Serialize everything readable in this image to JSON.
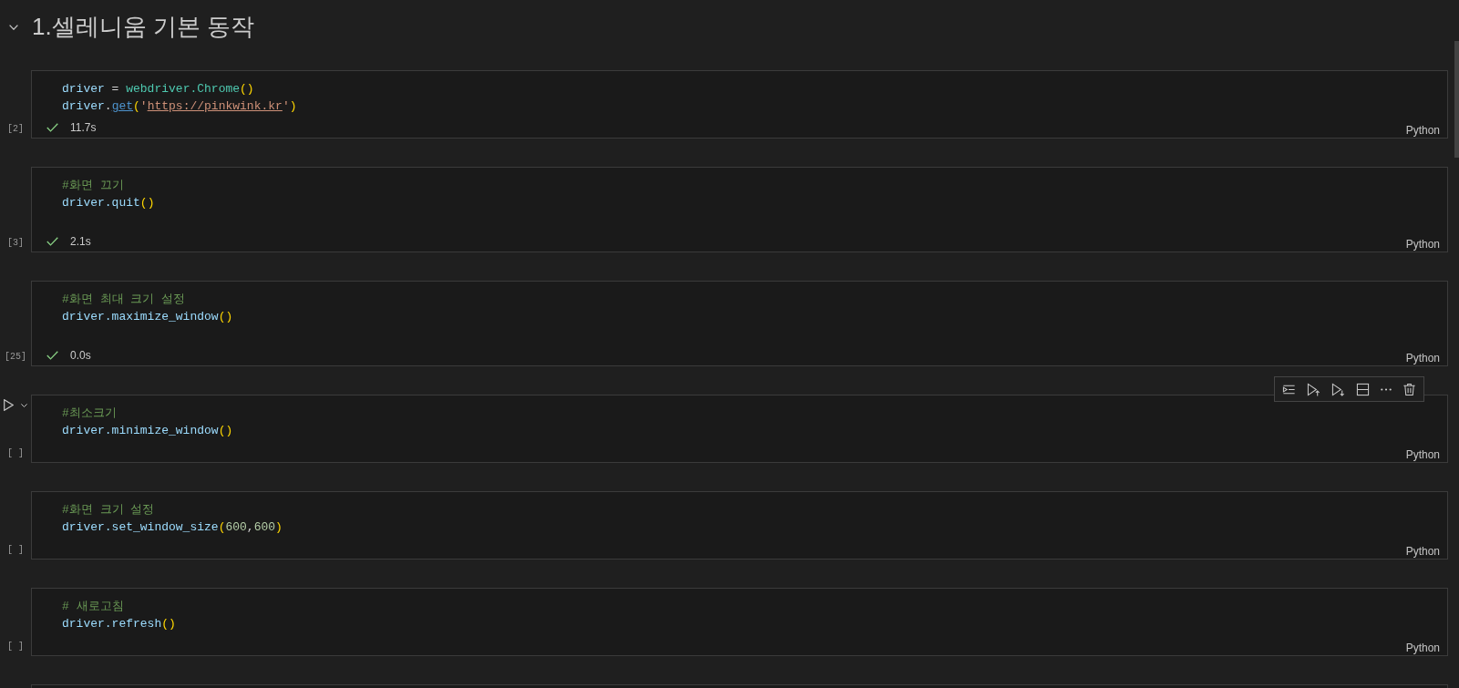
{
  "heading": {
    "text": "1.셀레니움 기본 동작",
    "expanded": true
  },
  "cells": [
    {
      "execution_count": "[2]",
      "focused": false,
      "blank_last_line": false,
      "lines": [
        [
          {
            "kind": "name",
            "text": "driver"
          },
          {
            "kind": "operator",
            "text": " = "
          },
          {
            "kind": "module",
            "text": "webdriver.Chrome"
          },
          {
            "kind": "bracket",
            "text": "()"
          }
        ],
        [
          {
            "kind": "name",
            "text": "driver"
          },
          {
            "kind": "operator",
            "text": "."
          },
          {
            "kind": "method_link",
            "text": "get"
          },
          {
            "kind": "bracket",
            "text": "("
          },
          {
            "kind": "string",
            "text": "'"
          },
          {
            "kind": "url",
            "text": "https://pinkwink.kr"
          },
          {
            "kind": "string",
            "text": "'"
          },
          {
            "kind": "bracket",
            "text": ")"
          }
        ]
      ],
      "status": {
        "succeeded": true,
        "duration": "11.7s"
      },
      "language": "Python"
    },
    {
      "execution_count": "[3]",
      "focused": false,
      "blank_last_line": true,
      "lines": [
        [
          {
            "kind": "comment",
            "text": "#화면 끄기"
          }
        ],
        [
          {
            "kind": "name",
            "text": "driver.quit"
          },
          {
            "kind": "bracket",
            "text": "()"
          }
        ]
      ],
      "status": {
        "succeeded": true,
        "duration": "2.1s"
      },
      "language": "Python"
    },
    {
      "execution_count": "[25]",
      "focused": false,
      "blank_last_line": true,
      "lines": [
        [
          {
            "kind": "comment",
            "text": "#화면 최대 크기 설정"
          }
        ],
        [
          {
            "kind": "name",
            "text": "driver.maximize_window"
          },
          {
            "kind": "bracket",
            "text": "()"
          }
        ]
      ],
      "status": {
        "succeeded": true,
        "duration": "0.0s"
      },
      "language": "Python"
    },
    {
      "execution_count": "[ ]",
      "focused": true,
      "blank_last_line": false,
      "lines": [
        [
          {
            "kind": "comment",
            "text": "#최소크기"
          }
        ],
        [
          {
            "kind": "name",
            "text": "driver.minimize_window"
          },
          {
            "kind": "bracket",
            "text": "()"
          }
        ]
      ],
      "language": "Python"
    },
    {
      "execution_count": "[ ]",
      "focused": false,
      "blank_last_line": false,
      "lines": [
        [
          {
            "kind": "comment",
            "text": "#화면 크기 설정"
          }
        ],
        [
          {
            "kind": "name",
            "text": "driver.set_window_size"
          },
          {
            "kind": "bracket",
            "text": "("
          },
          {
            "kind": "number",
            "text": "600"
          },
          {
            "kind": "operator",
            "text": ","
          },
          {
            "kind": "number",
            "text": "600"
          },
          {
            "kind": "bracket",
            "text": ")"
          }
        ]
      ],
      "language": "Python"
    },
    {
      "execution_count": "[ ]",
      "focused": false,
      "blank_last_line": false,
      "lines": [
        [
          {
            "kind": "comment",
            "text": "# 새로고침"
          }
        ],
        [
          {
            "kind": "name",
            "text": "driver.refresh"
          },
          {
            "kind": "bracket",
            "text": "()"
          }
        ]
      ],
      "language": "Python"
    }
  ],
  "next_cell_partly_visible": true
}
